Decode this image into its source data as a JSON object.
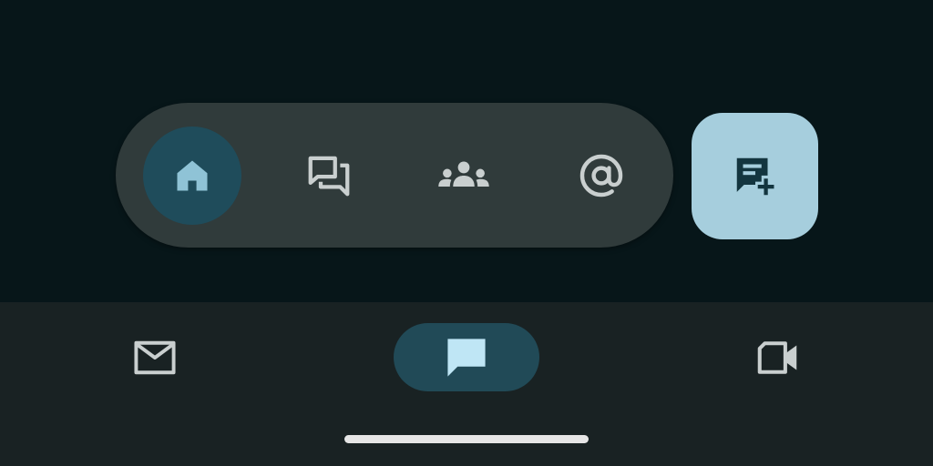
{
  "colors": {
    "background": "#071619",
    "floating_bar": "#303b3b",
    "selected_pill": "#1f4c5b",
    "fab": "#a6cedd",
    "fab_icon": "#13353f",
    "icon_active": "#8fc3d6",
    "icon_inactive": "#c9cfcf",
    "bottom_nav": "#192223",
    "bottom_selected_icon": "#bfe6f5",
    "home_indicator": "#e6e6e6"
  },
  "floating_bar": {
    "items": [
      {
        "id": "home",
        "icon": "home-icon",
        "selected": true
      },
      {
        "id": "direct-messages",
        "icon": "chat-bubbles-icon",
        "selected": false
      },
      {
        "id": "spaces",
        "icon": "group-icon",
        "selected": false
      },
      {
        "id": "mentions",
        "icon": "at-sign-icon",
        "selected": false
      }
    ]
  },
  "fab": {
    "icon": "new-chat-icon"
  },
  "bottom_nav": {
    "items": [
      {
        "id": "mail",
        "icon": "mail-icon",
        "selected": false
      },
      {
        "id": "chat",
        "icon": "chat-icon",
        "selected": true
      },
      {
        "id": "meet",
        "icon": "video-camera-icon",
        "selected": false
      }
    ]
  }
}
